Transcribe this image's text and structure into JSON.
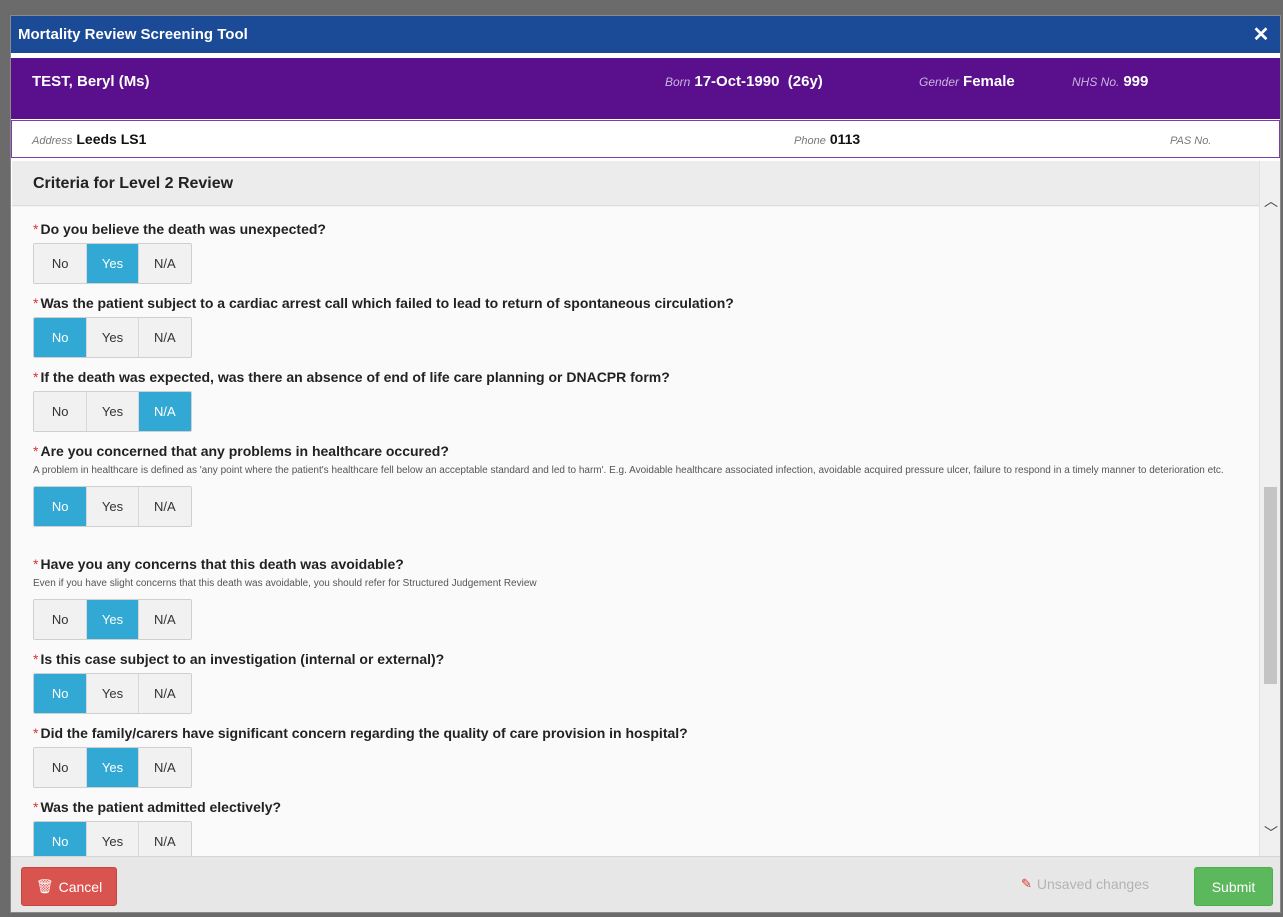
{
  "modal": {
    "title": "Mortality Review Screening Tool"
  },
  "patient": {
    "name": "TEST, Beryl (Ms)",
    "born_label": "Born",
    "born": "17-Oct-1990",
    "age": "(26y)",
    "gender_label": "Gender",
    "gender": "Female",
    "nhs_label": "NHS No.",
    "nhs": "999",
    "address_label": "Address",
    "address": "Leeds LS1",
    "phone_label": "Phone",
    "phone": "0113",
    "pas_label": "PAS No."
  },
  "section": {
    "title": "Criteria for Level 2 Review"
  },
  "options": [
    "No",
    "Yes",
    "N/A"
  ],
  "questions": [
    {
      "text": "Do you believe the death was unexpected?",
      "help": "",
      "selected": "Yes"
    },
    {
      "text": "Was the patient subject to a cardiac arrest call which failed to lead to return of spontaneous circulation?",
      "help": "",
      "selected": "No"
    },
    {
      "text": "If the death was expected, was there an absence of end of life care planning or DNACPR form?",
      "help": "",
      "selected": "N/A"
    },
    {
      "text": "Are you concerned that any problems in healthcare occured?",
      "help": "A problem in healthcare is defined as 'any point where the patient's healthcare fell below an acceptable standard and led to harm'. E.g. Avoidable healthcare associated infection, avoidable acquired pressure ulcer, failure to respond in a timely manner to deterioration etc.",
      "selected": "No"
    },
    {
      "text": "Have you any concerns that this death was avoidable?",
      "help": "Even if you have slight concerns that this death was avoidable, you should refer for Structured Judgement Review",
      "selected": "Yes"
    },
    {
      "text": "Is this case subject to an investigation (internal or external)?",
      "help": "",
      "selected": "No"
    },
    {
      "text": "Did the family/carers have significant concern regarding the quality of care provision in hospital?",
      "help": "",
      "selected": "Yes"
    },
    {
      "text": "Was the patient admitted electively?",
      "help": "",
      "selected": "No"
    }
  ],
  "footer": {
    "cancel_label": "Cancel",
    "unsaved_label": "Unsaved changes",
    "submit_label": "Submit"
  },
  "icons": {
    "close": "close-icon",
    "trash": "trash-icon",
    "pencil": "pencil-icon",
    "chevron_up": "chevron-up-icon",
    "chevron_down": "chevron-down-icon"
  },
  "colors": {
    "titlebar": "#1b4a97",
    "banner": "#5a0f8c",
    "selected": "#31a9d4",
    "cancel": "#d9534f",
    "submit": "#5cb85c",
    "required": "#d9362e"
  }
}
